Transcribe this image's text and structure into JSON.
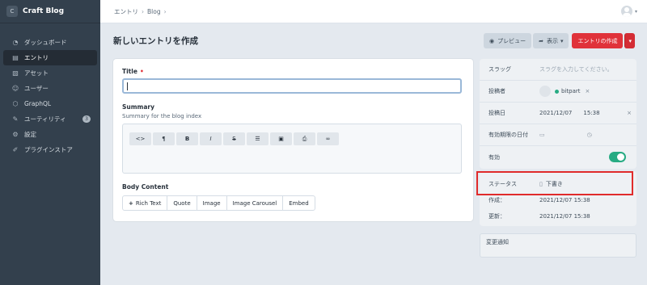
{
  "brand": {
    "logo_letter": "C",
    "name": "Craft Blog"
  },
  "sidebar": {
    "items": [
      {
        "label": "ダッシュボード",
        "icon": "dashboard-icon",
        "glyph": "◔"
      },
      {
        "label": "エントリ",
        "icon": "entries-icon",
        "glyph": "▤",
        "active": true
      },
      {
        "label": "アセット",
        "icon": "assets-icon",
        "glyph": "▧"
      },
      {
        "label": "ユーザー",
        "icon": "users-icon",
        "glyph": "☺"
      },
      {
        "label": "GraphQL",
        "icon": "graphql-icon",
        "glyph": "⬡"
      },
      {
        "label": "ユーティリティ",
        "icon": "utilities-icon",
        "glyph": "✎",
        "badge": "3"
      },
      {
        "label": "設定",
        "icon": "settings-icon",
        "glyph": "⚙"
      },
      {
        "label": "プラグインストア",
        "icon": "plugin-store-icon",
        "glyph": "✐"
      }
    ]
  },
  "breadcrumb": {
    "items": [
      "エントリ",
      "Blog"
    ],
    "separator": "›"
  },
  "page": {
    "title": "新しいエントリを作成"
  },
  "toolbar": {
    "preview_label": "プレビュー",
    "view_label": "表示",
    "create_label": "エントリの作成",
    "dropdown_glyph": "▾"
  },
  "form": {
    "title_label": "Title",
    "required_mark": "•",
    "summary_label": "Summary",
    "summary_instructions": "Summary for the blog index",
    "rte_buttons": [
      {
        "glyph": "<>",
        "name": "code-icon"
      },
      {
        "glyph": "¶",
        "name": "paragraph-icon"
      },
      {
        "glyph": "B",
        "name": "bold-icon"
      },
      {
        "glyph": "I",
        "name": "italic-icon"
      },
      {
        "glyph": "S",
        "name": "strikethrough-icon"
      },
      {
        "glyph": "☰",
        "name": "list-icon"
      },
      {
        "glyph": "▣",
        "name": "image-icon"
      },
      {
        "glyph": "⎙",
        "name": "embed-icon"
      },
      {
        "glyph": "∞",
        "name": "link-icon"
      }
    ],
    "body_label": "Body Content",
    "block_buttons": [
      "Rich Text",
      "Quote",
      "Image",
      "Image Carousel",
      "Embed"
    ],
    "add_glyph": "+"
  },
  "meta": {
    "slug_label": "スラッグ",
    "slug_placeholder": "スラグを入力してください。",
    "author_label": "投稿者",
    "author_name": "bitpart",
    "author_status_color": "#27ab83",
    "remove_glyph": "×",
    "post_date_label": "投稿日",
    "post_date": "2021/12/07",
    "post_time": "15:38",
    "expiry_label": "有効期限の日付",
    "calendar_glyph": "▭",
    "clock_glyph": "◷",
    "enabled_label": "有効",
    "enabled": true
  },
  "status": {
    "status_label": "ステータス",
    "status_value": "下書き",
    "created_label": "作成：",
    "created_value": "2021/12/07 15:38",
    "updated_label": "更新：",
    "updated_value": "2021/12/07 15:38"
  },
  "notes": {
    "placeholder": "変更通知"
  },
  "colors": {
    "accent_red": "#e0323a",
    "highlight": "#e02b2b",
    "toggle_on": "#27ab83",
    "sidebar_bg": "#33404d"
  }
}
